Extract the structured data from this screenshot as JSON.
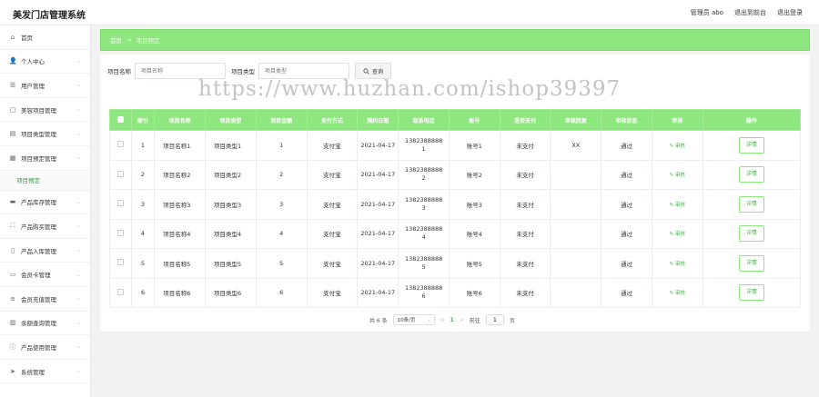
{
  "header": {
    "title": "美发门店管理系统",
    "links": [
      "管理员 abo",
      "退出到前台",
      "退出登录"
    ]
  },
  "sidebar": {
    "items": [
      {
        "icon": "home-icon",
        "glyph": "⌂",
        "label": "首页",
        "chevron": false
      },
      {
        "icon": "user-icon",
        "glyph": "👤",
        "label": "个人中心",
        "chevron": true
      },
      {
        "icon": "users-icon",
        "glyph": "☰",
        "label": "用户管理",
        "chevron": true
      },
      {
        "icon": "comment-icon",
        "glyph": "▢",
        "label": "美容项目管理",
        "chevron": true
      },
      {
        "icon": "list-icon",
        "glyph": "▤",
        "label": "项目类型管理",
        "chevron": true
      },
      {
        "icon": "grid-icon",
        "glyph": "▦",
        "label": "项目预定管理",
        "chevron": true,
        "sub": [
          "项目预定"
        ]
      },
      {
        "icon": "box-icon",
        "glyph": "▬",
        "label": "产品库存管理",
        "chevron": true
      },
      {
        "icon": "fullscreen-icon",
        "glyph": "⛶",
        "label": "产品购买管理",
        "chevron": true
      },
      {
        "icon": "phone-icon",
        "glyph": "▯",
        "label": "产品入库管理",
        "chevron": true
      },
      {
        "icon": "card-icon",
        "glyph": "▭",
        "label": "会员卡管理",
        "chevron": true
      },
      {
        "icon": "menu-icon",
        "glyph": "≡",
        "label": "会员充值管理",
        "chevron": true
      },
      {
        "icon": "chart-icon",
        "glyph": "▥",
        "label": "余额查询管理",
        "chevron": true
      },
      {
        "icon": "info-icon",
        "glyph": "ⓘ",
        "label": "产品使用管理",
        "chevron": true
      },
      {
        "icon": "send-icon",
        "glyph": "➤",
        "label": "系统管理",
        "chevron": true
      }
    ]
  },
  "breadcrumb": {
    "home": "首页",
    "separator": "→",
    "current": "项目预定"
  },
  "search": {
    "name_label": "项目名称",
    "name_placeholder": "项目名称",
    "type_label": "项目类型",
    "type_placeholder": "项目类型",
    "button_label": "查询"
  },
  "watermark": "https://www.huzhan.com/ishop39397",
  "table": {
    "headers": [
      "索引",
      "项目名称",
      "项目类型",
      "项目金额",
      "支付方式",
      "预约日期",
      "联系电话",
      "账号",
      "是否支付",
      "审核回复",
      "审核状态",
      "审核",
      "操作"
    ],
    "audit_label": "审核",
    "detail_label": "详情",
    "rows": [
      {
        "index": "1",
        "name": "项目名称1",
        "type": "项目类型1",
        "amount": "1",
        "pay_method": "支付宝",
        "date": "2021-04-17",
        "phone_a": "1382388888",
        "phone_b": "1",
        "account": "账号1",
        "paid": "未支付",
        "reply": "XX",
        "status": "通过"
      },
      {
        "index": "2",
        "name": "项目名称2",
        "type": "项目类型2",
        "amount": "2",
        "pay_method": "支付宝",
        "date": "2021-04-17",
        "phone_a": "1382388888",
        "phone_b": "2",
        "account": "账号2",
        "paid": "未支付",
        "reply": "",
        "status": "通过"
      },
      {
        "index": "3",
        "name": "项目名称3",
        "type": "项目类型3",
        "amount": "3",
        "pay_method": "支付宝",
        "date": "2021-04-17",
        "phone_a": "1382388888",
        "phone_b": "3",
        "account": "账号3",
        "paid": "未支付",
        "reply": "",
        "status": "通过"
      },
      {
        "index": "4",
        "name": "项目名称4",
        "type": "项目类型4",
        "amount": "4",
        "pay_method": "支付宝",
        "date": "2021-04-17",
        "phone_a": "1382388888",
        "phone_b": "4",
        "account": "账号4",
        "paid": "未支付",
        "reply": "",
        "status": "通过"
      },
      {
        "index": "5",
        "name": "项目名称5",
        "type": "项目类型5",
        "amount": "5",
        "pay_method": "支付宝",
        "date": "2021-04-17",
        "phone_a": "1382388888",
        "phone_b": "5",
        "account": "账号5",
        "paid": "未支付",
        "reply": "",
        "status": "通过"
      },
      {
        "index": "6",
        "name": "项目名称6",
        "type": "项目类型6",
        "amount": "6",
        "pay_method": "支付宝",
        "date": "2021-04-17",
        "phone_a": "1382388888",
        "phone_b": "6",
        "account": "账号6",
        "paid": "未支付",
        "reply": "",
        "status": "通过"
      }
    ]
  },
  "pagination": {
    "total": "共 6 条",
    "page_size": "10条/页",
    "prev": "<",
    "page": "1",
    "next": ">",
    "goto_label": "前往",
    "goto_value": "1",
    "goto_suffix": "页"
  },
  "colors": {
    "accent": "#8ee77e",
    "link": "#4caf50"
  }
}
